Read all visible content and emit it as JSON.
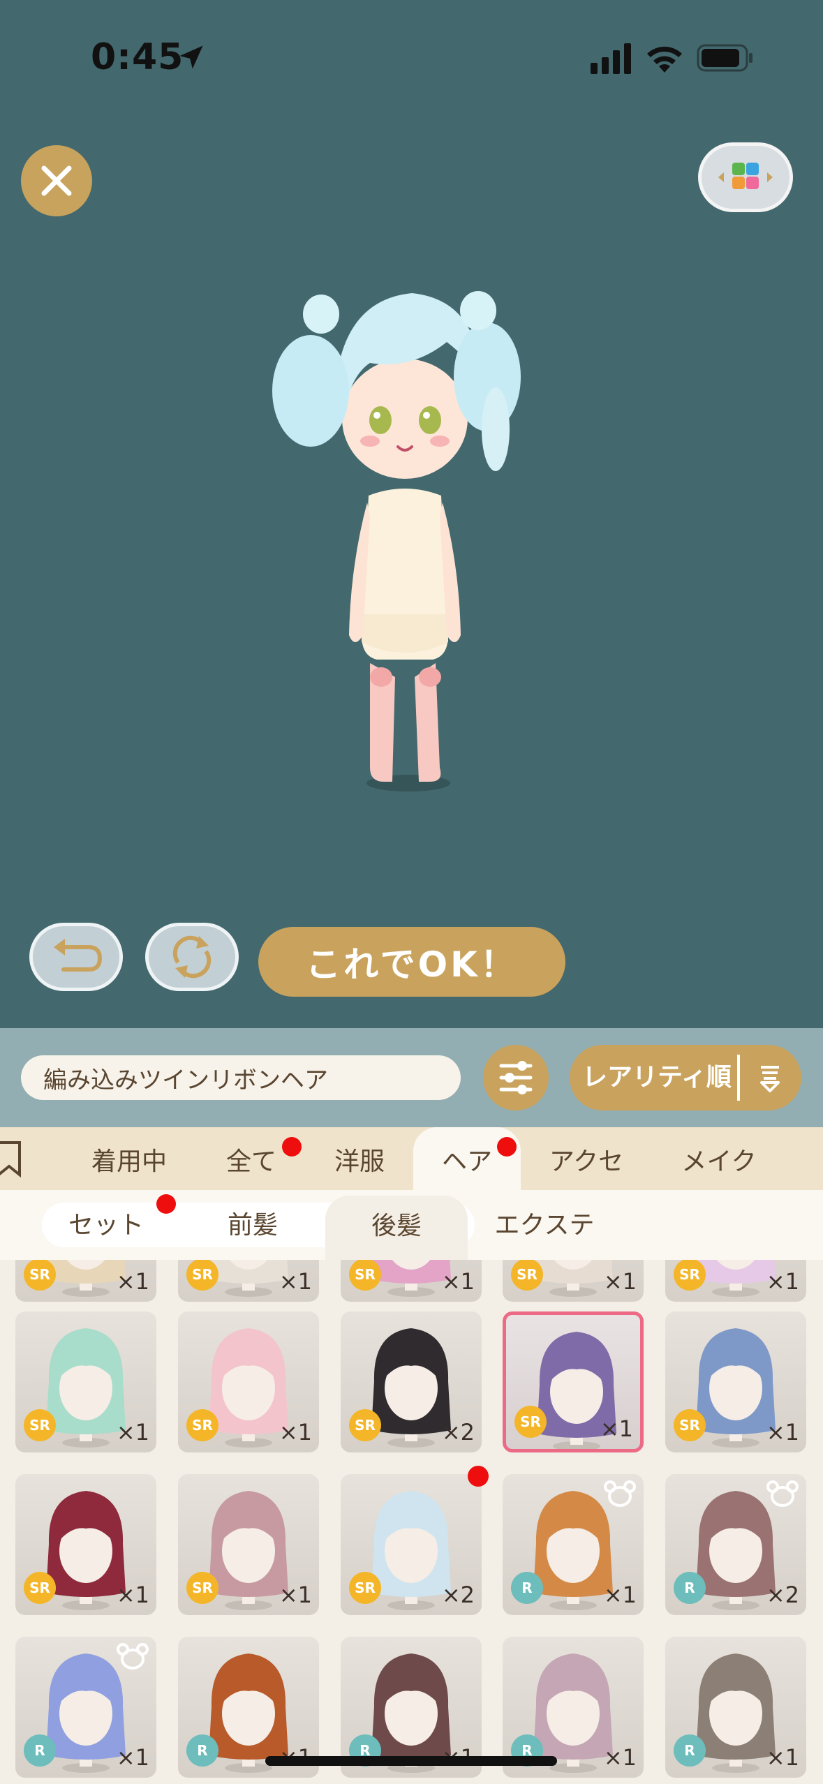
{
  "status_bar": {
    "time": "0:45"
  },
  "preview": {
    "ok_label": "これでOK！"
  },
  "toolbar": {
    "item_name": "編み込みツインリボンヘア",
    "sort_label": "レアリティ順"
  },
  "tabs": [
    {
      "label": "着用中",
      "badge": false
    },
    {
      "label": "全て",
      "badge": true
    },
    {
      "label": "洋服",
      "badge": false
    },
    {
      "label": "ヘア",
      "badge": true,
      "active": true
    },
    {
      "label": "アクセ",
      "badge": false
    },
    {
      "label": "メイク",
      "badge": false
    }
  ],
  "subtabs": [
    {
      "label": "セット",
      "badge": true
    },
    {
      "label": "前髪",
      "badge": false
    },
    {
      "label": "後髪",
      "active": true
    },
    {
      "label": "エクステ"
    }
  ],
  "items": [
    {
      "rarity": "SR",
      "qty": "×1",
      "hair": "#e8d6b8"
    },
    {
      "rarity": "SR",
      "qty": "×1",
      "hair": "#e6e0d6"
    },
    {
      "rarity": "SR",
      "qty": "×1",
      "hair": "#e3a4c8"
    },
    {
      "rarity": "SR",
      "qty": "×1",
      "hair": "#e6dcd2"
    },
    {
      "rarity": "SR",
      "qty": "×1",
      "hair": "#e6c9e6"
    },
    {
      "rarity": "SR",
      "qty": "×1",
      "hair": "#a8dccb"
    },
    {
      "rarity": "SR",
      "qty": "×1",
      "hair": "#f4c4cc"
    },
    {
      "rarity": "SR",
      "qty": "×2",
      "hair": "#2f2b2f"
    },
    {
      "rarity": "SR",
      "qty": "×1",
      "hair": "#7f6ba8",
      "selected": true
    },
    {
      "rarity": "SR",
      "qty": "×1",
      "hair": "#7e98c8"
    },
    {
      "rarity": "SR",
      "qty": "×1",
      "hair": "#8e2a3c"
    },
    {
      "rarity": "SR",
      "qty": "×1",
      "hair": "#c79aa2"
    },
    {
      "rarity": "SR",
      "qty": "×2",
      "hair": "#cfe4ee",
      "badge": true
    },
    {
      "rarity": "R",
      "qty": "×1",
      "hair": "#d48a46",
      "bear": true
    },
    {
      "rarity": "R",
      "qty": "×2",
      "hair": "#9a7272",
      "bear": true
    },
    {
      "rarity": "R",
      "qty": "×1",
      "hair": "#8f9fdf",
      "bear": true
    },
    {
      "rarity": "R",
      "qty": "×1",
      "hair": "#b85a2a"
    },
    {
      "rarity": "R",
      "qty": "×1",
      "hair": "#6e4a4a"
    },
    {
      "rarity": "R",
      "qty": "×1",
      "hair": "#c4a6b4"
    },
    {
      "rarity": "R",
      "qty": "×1",
      "hair": "#8c7f76"
    }
  ],
  "icons": {
    "close": "close-icon",
    "switch": "color-grid-icon",
    "undo": "undo-icon",
    "reset": "rotate-icon",
    "filter": "sliders-icon",
    "sort": "sort-icon",
    "bookmark": "bookmark-icon",
    "bear": "bear-icon"
  },
  "colors": {
    "preview_bg": "#43686d",
    "accent_gold": "#c9a35d",
    "badge_red": "#ee0e0e",
    "sr_badge": "#f4b628",
    "r_badge": "#6cbdbb",
    "selected_border": "#ec6a86"
  }
}
